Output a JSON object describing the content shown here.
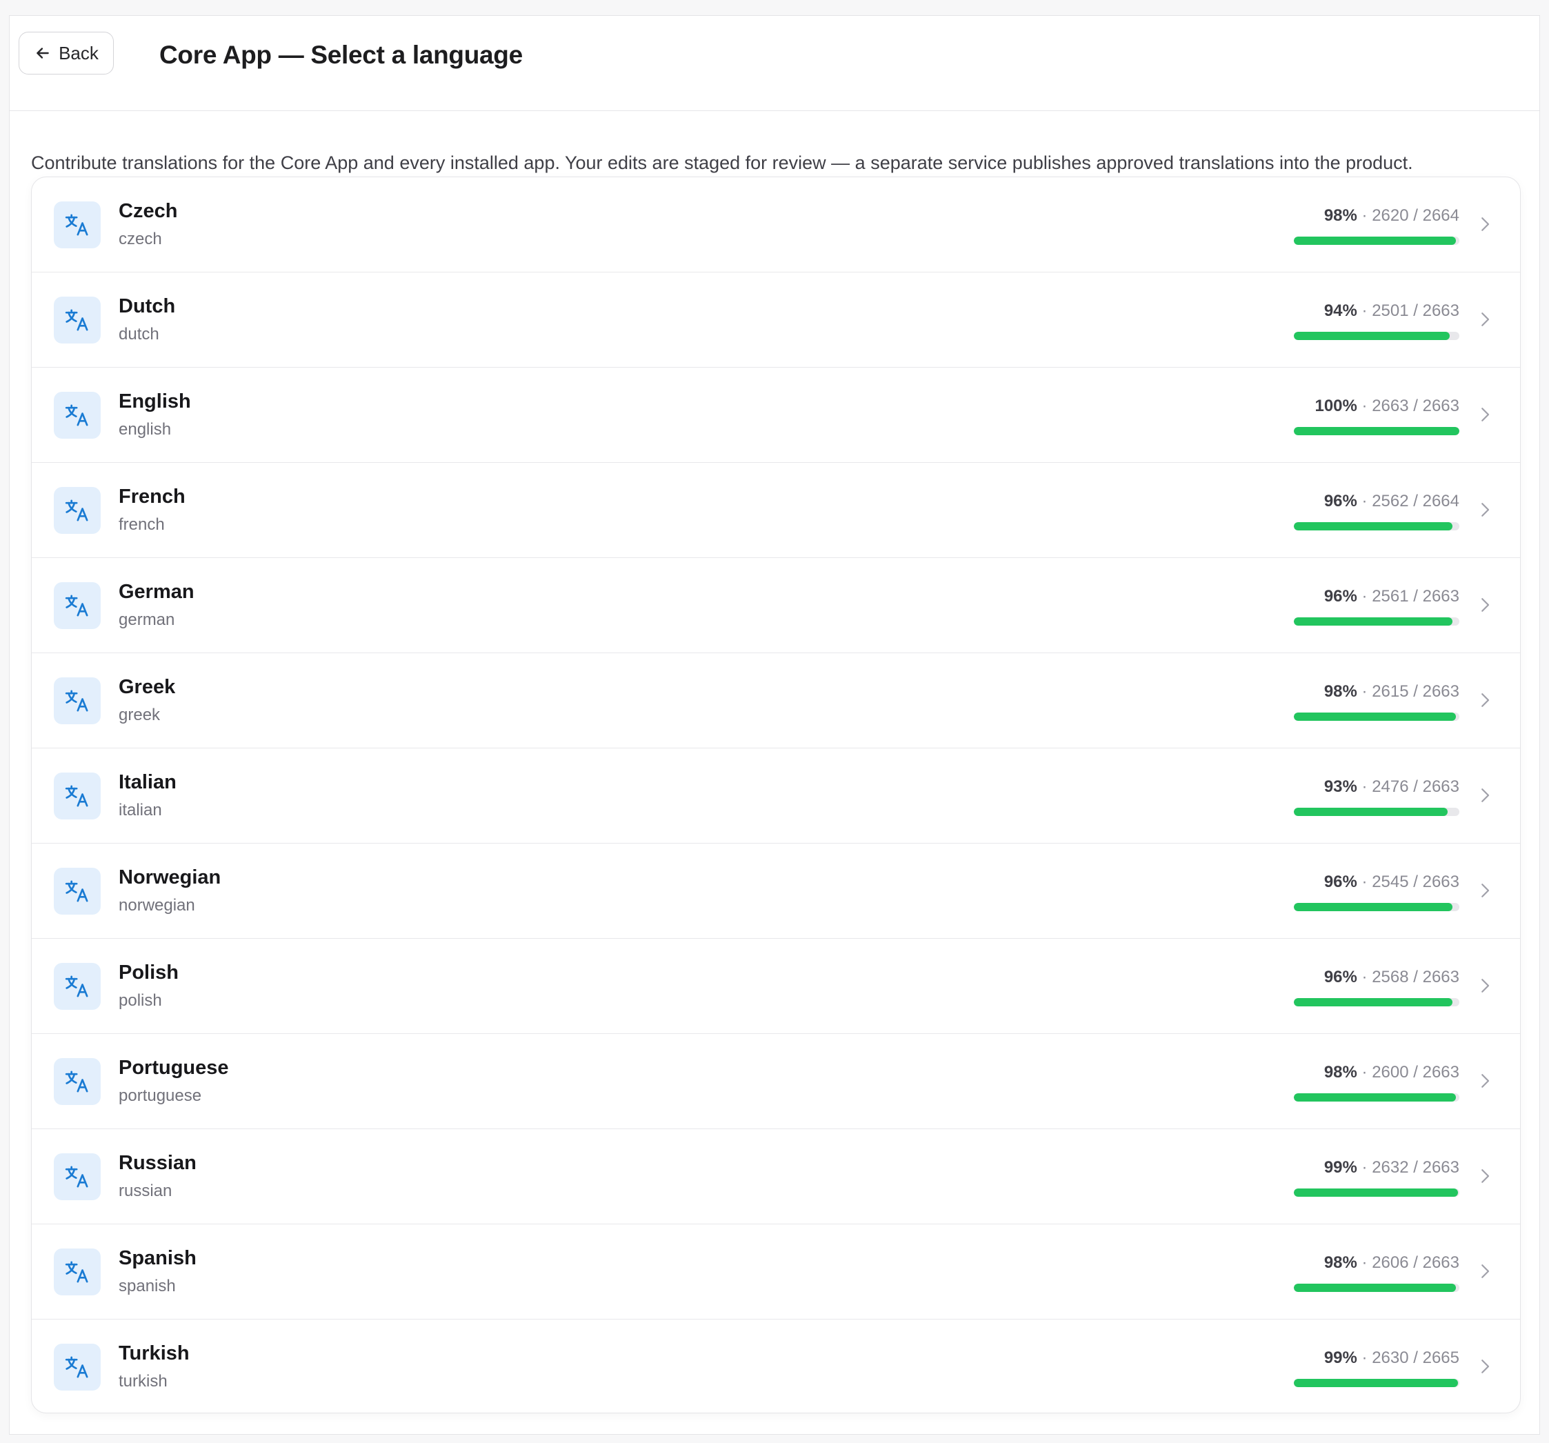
{
  "header": {
    "back_label": "Back",
    "title": "Core App — Select a language"
  },
  "description": "Contribute translations for the Core App and every installed app. Your edits are staged for review — a separate service publishes approved translations into the product.",
  "colors": {
    "progress_fill": "#22c55e",
    "progress_track": "#e8e8eb",
    "icon_bg": "#e3effc",
    "icon_fg": "#1a7bd3"
  },
  "languages": [
    {
      "name": "Czech",
      "code": "czech",
      "percent": "98%",
      "counts": "2620 / 2664",
      "progress": 0.98
    },
    {
      "name": "Dutch",
      "code": "dutch",
      "percent": "94%",
      "counts": "2501 / 2663",
      "progress": 0.94
    },
    {
      "name": "English",
      "code": "english",
      "percent": "100%",
      "counts": "2663 / 2663",
      "progress": 1.0
    },
    {
      "name": "French",
      "code": "french",
      "percent": "96%",
      "counts": "2562 / 2664",
      "progress": 0.96
    },
    {
      "name": "German",
      "code": "german",
      "percent": "96%",
      "counts": "2561 / 2663",
      "progress": 0.96
    },
    {
      "name": "Greek",
      "code": "greek",
      "percent": "98%",
      "counts": "2615 / 2663",
      "progress": 0.98
    },
    {
      "name": "Italian",
      "code": "italian",
      "percent": "93%",
      "counts": "2476 / 2663",
      "progress": 0.93
    },
    {
      "name": "Norwegian",
      "code": "norwegian",
      "percent": "96%",
      "counts": "2545 / 2663",
      "progress": 0.96
    },
    {
      "name": "Polish",
      "code": "polish",
      "percent": "96%",
      "counts": "2568 / 2663",
      "progress": 0.96
    },
    {
      "name": "Portuguese",
      "code": "portuguese",
      "percent": "98%",
      "counts": "2600 / 2663",
      "progress": 0.98
    },
    {
      "name": "Russian",
      "code": "russian",
      "percent": "99%",
      "counts": "2632 / 2663",
      "progress": 0.99
    },
    {
      "name": "Spanish",
      "code": "spanish",
      "percent": "98%",
      "counts": "2606 / 2663",
      "progress": 0.98
    },
    {
      "name": "Turkish",
      "code": "turkish",
      "percent": "99%",
      "counts": "2630 / 2665",
      "progress": 0.99
    }
  ]
}
